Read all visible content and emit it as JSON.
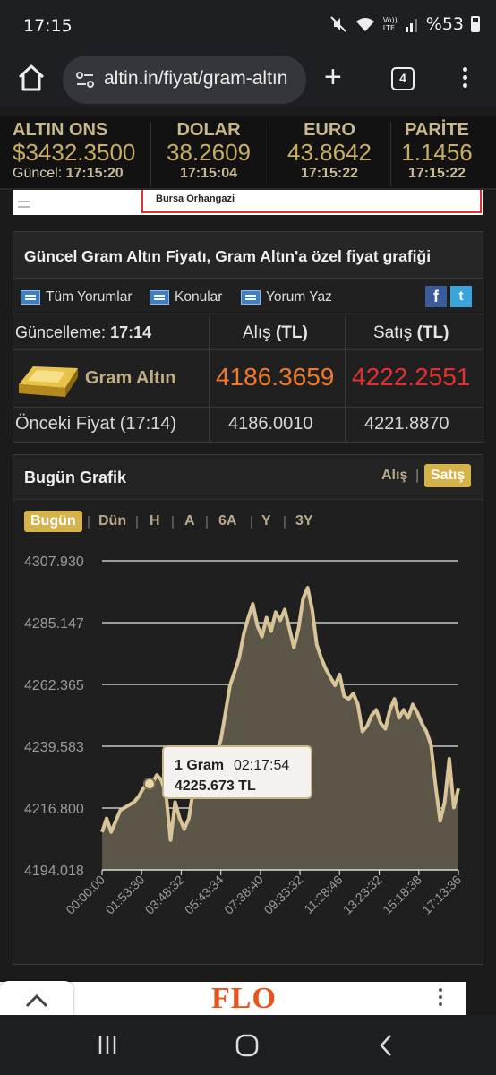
{
  "status": {
    "time": "17:15",
    "battery": "%53",
    "volte": "Vo)) LTE"
  },
  "browser": {
    "url": "altin.in/fiyat/gram-altın",
    "tab_count": "4"
  },
  "ticker": [
    {
      "name": "ALTIN ONS",
      "value": "$3432.3500",
      "time_label": "Güncel:",
      "time": "17:15:20"
    },
    {
      "name": "DOLAR",
      "value": "38.2609",
      "time_label": "",
      "time": "17:15:04"
    },
    {
      "name": "EURO",
      "value": "43.8642",
      "time_label": "",
      "time": "17:15:22"
    },
    {
      "name": "PARİTE",
      "value": "1.1456",
      "time_label": "",
      "time": "17:15:22"
    }
  ],
  "ad_top": {
    "text": "Bursa Orhangazi"
  },
  "panel": {
    "title": "Güncel Gram Altın Fiyatı, Gram Altın'a özel fiyat grafiği",
    "links": [
      "Tüm Yorumlar",
      "Konular",
      "Yorum Yaz"
    ],
    "social": [
      "f",
      "t"
    ],
    "update_label": "Güncelleme:",
    "update_time": "17:14",
    "col_buy": "Alış",
    "col_sell": "Satış",
    "unit": "(TL)",
    "product": "Gram Altın",
    "buy": "4186.3659",
    "sell": "4222.2551",
    "prev_label": "Önceki Fiyat (17:14)",
    "prev_buy": "4186.0010",
    "prev_sell": "4221.8870",
    "buy_color": "#f07a2a",
    "sell_color": "#e53030"
  },
  "chart_panel": {
    "title": "Bugün Grafik",
    "switch_buy": "Alış",
    "switch_sell": "Satış",
    "ranges": [
      "Bugün",
      "Dün",
      "H",
      "A",
      "6A",
      "Y",
      "3Y"
    ],
    "active_range": "Bugün",
    "tooltip_name": "1 Gram",
    "tooltip_time": "02:17:54",
    "tooltip_value": "4225.673 TL"
  },
  "chart_data": {
    "type": "area",
    "title": "",
    "xlabel": "",
    "ylabel": "",
    "ylim": [
      4194.018,
      4307.93
    ],
    "y_ticks": [
      "4307.930",
      "4285.147",
      "4262.365",
      "4239.583",
      "4216.800",
      "4194.018"
    ],
    "x_ticks": [
      "00:00:00",
      "01:53:30",
      "03:48:32",
      "05:43:34",
      "07:38:40",
      "09:33:32",
      "11:28:46",
      "13:23:32",
      "15:18:38",
      "17:13:36"
    ],
    "series": [
      {
        "values": [
          4208,
          4213,
          4208,
          4212,
          4216,
          4217,
          4218,
          4219,
          4221,
          4224,
          4226,
          4226,
          4229,
          4227,
          4222,
          4205,
          4219,
          4213,
          4209,
          4213,
          4224,
          4225,
          4228,
          4236,
          4235,
          4237,
          4242,
          4252,
          4262,
          4267,
          4272,
          4281,
          4287,
          4292,
          4284,
          4280,
          4287,
          4282,
          4289,
          4286,
          4290,
          4283,
          4276,
          4283,
          4294,
          4298,
          4290,
          4277,
          4272,
          4268,
          4265,
          4262,
          4266,
          4258,
          4257,
          4259,
          4255,
          4245,
          4247,
          4251,
          4253,
          4248,
          4246,
          4253,
          4257,
          4250,
          4253,
          4250,
          4255,
          4252,
          4248,
          4245,
          4240,
          4225,
          4212,
          4219,
          4235,
          4217,
          4224
        ]
      }
    ],
    "tooltip_point": {
      "x": "02:17:54",
      "y": 4225.673
    },
    "fill_color": "#5c5649",
    "line_color": "#d8c497",
    "grid": true
  },
  "bottom_ad": {
    "brand": "FLO"
  }
}
